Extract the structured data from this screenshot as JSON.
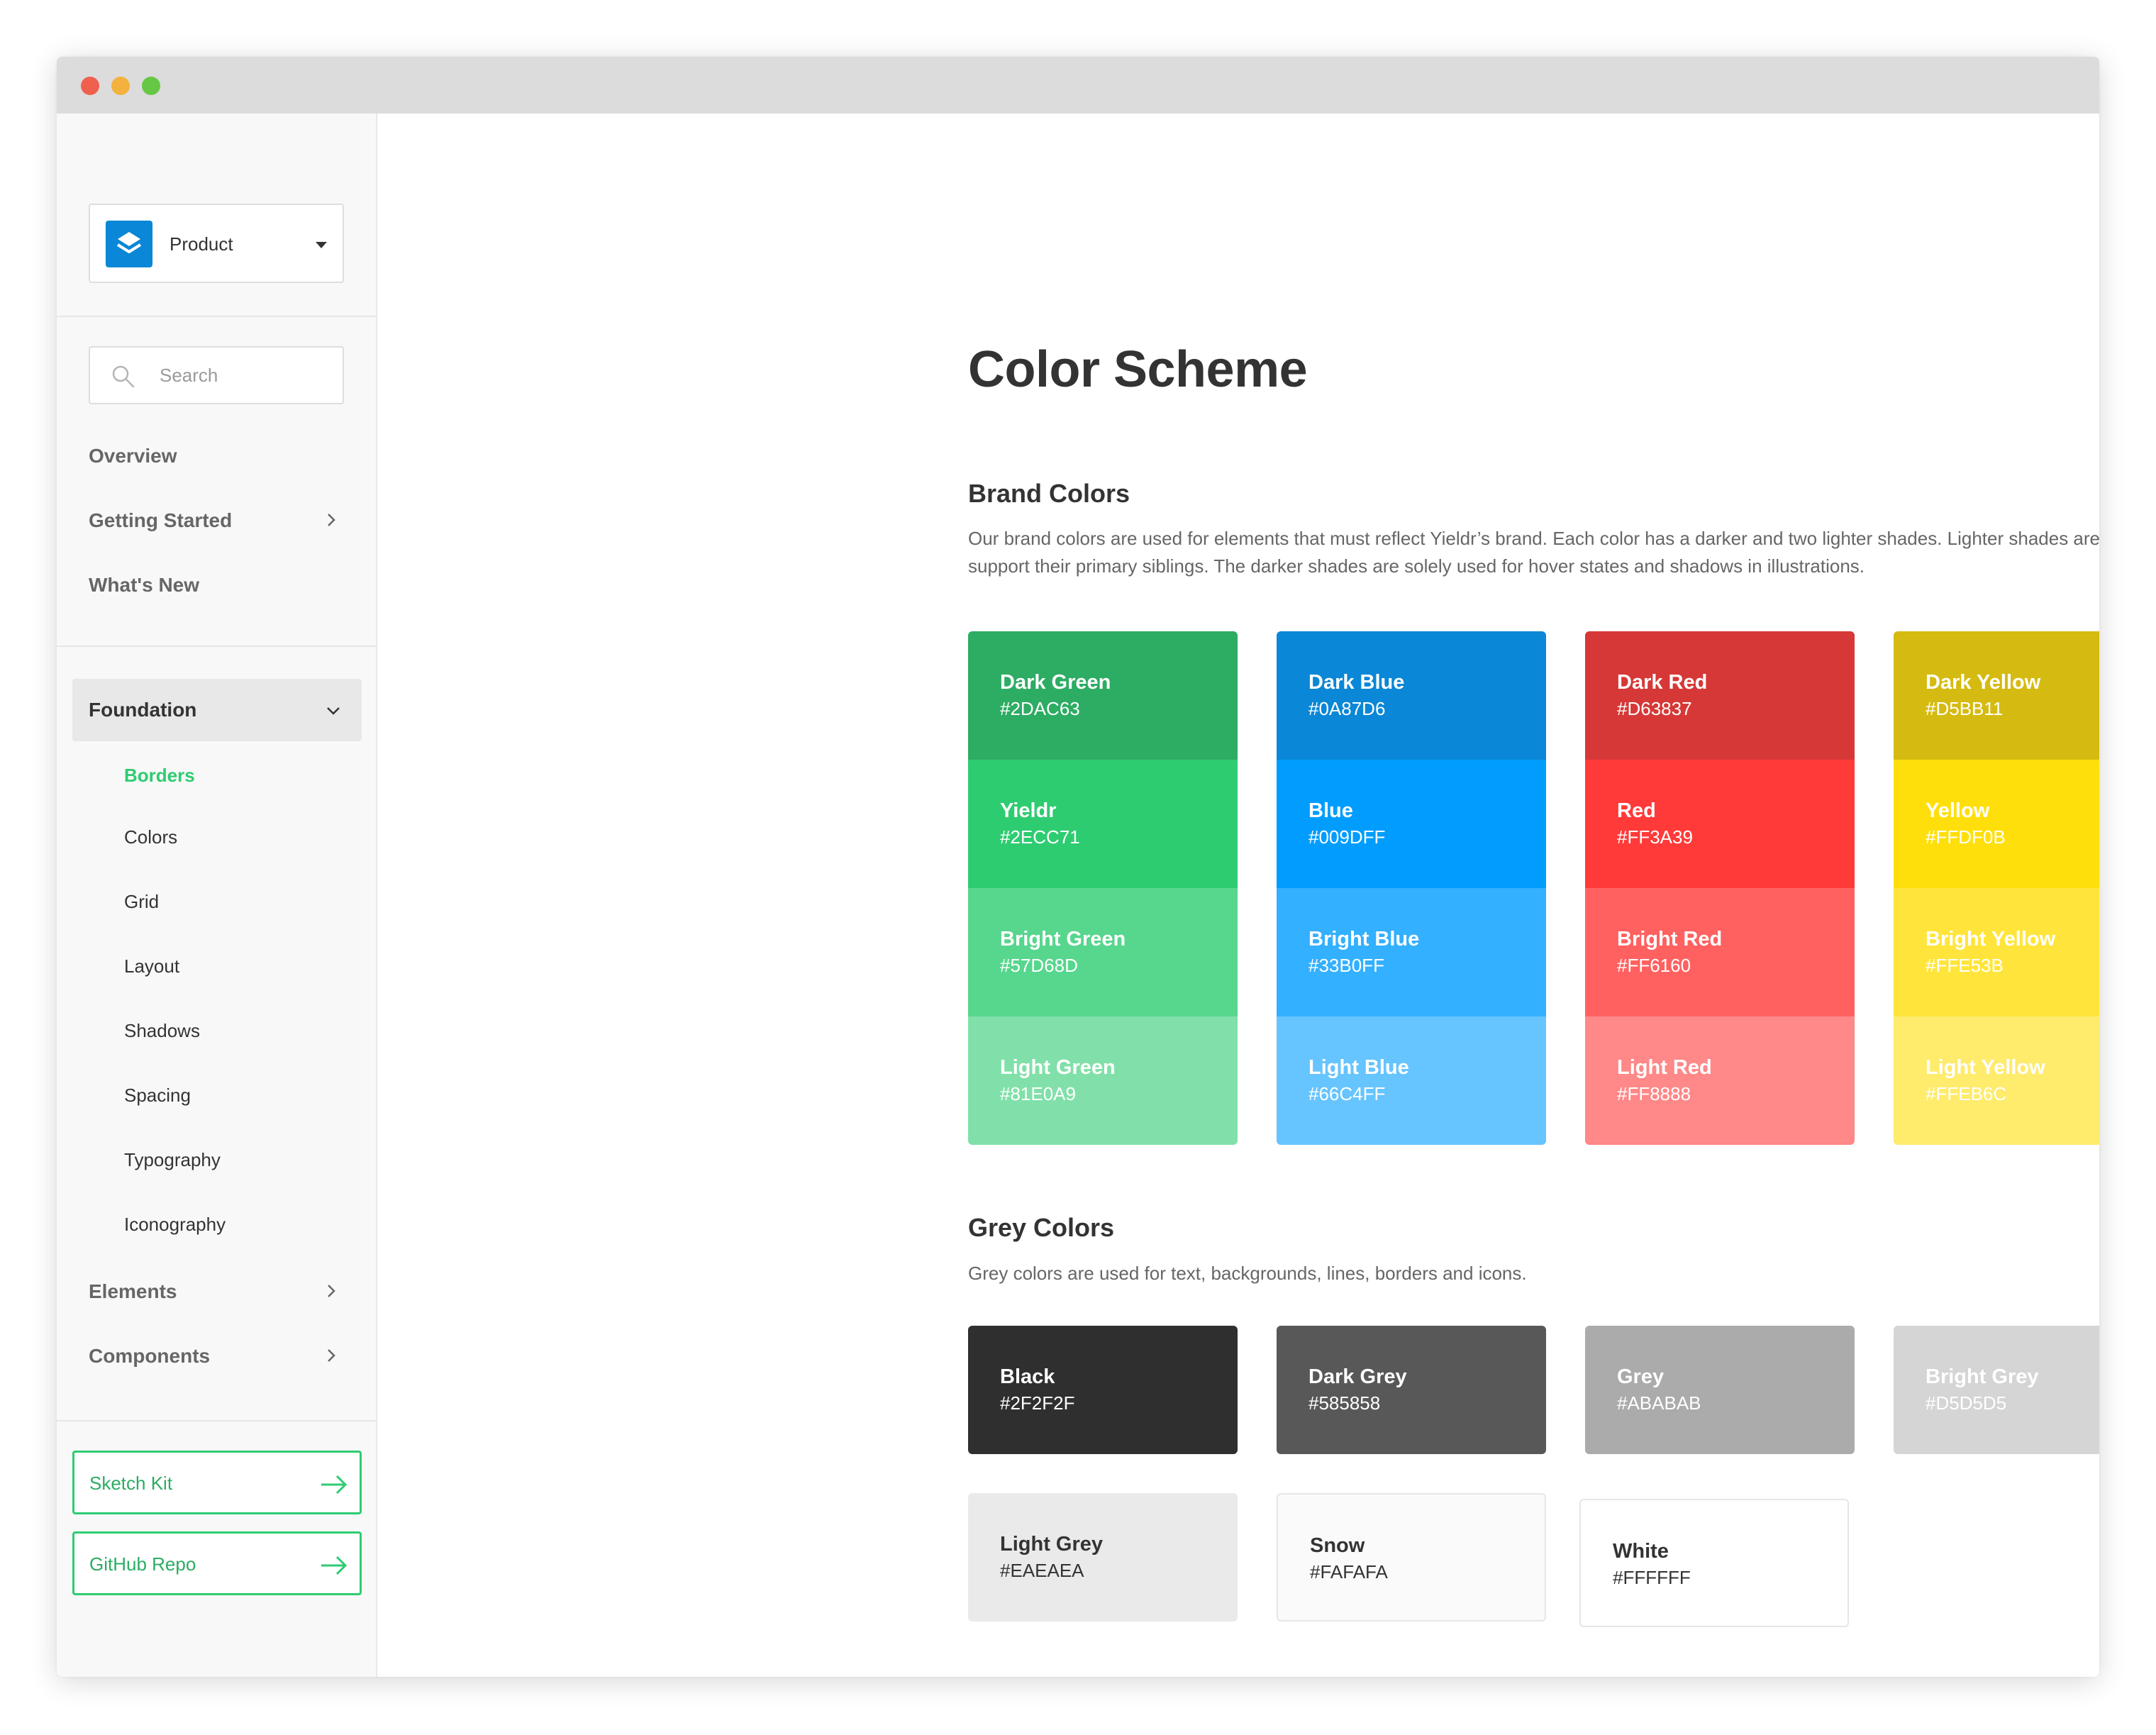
{
  "sidebar": {
    "product": {
      "label": "Product"
    },
    "search": {
      "placeholder": "Search"
    },
    "nav": {
      "overview": "Overview",
      "getting_started": "Getting Started",
      "whats_new": "What's New",
      "foundation": "Foundation",
      "foundation_items": [
        "Borders",
        "Colors",
        "Grid",
        "Layout",
        "Shadows",
        "Spacing",
        "Typography",
        "Iconography"
      ],
      "elements": "Elements",
      "components": "Components"
    },
    "links": {
      "sketch_kit": "Sketch Kit",
      "github_repo": "GitHub Repo"
    }
  },
  "main": {
    "title": "Color Scheme",
    "brand": {
      "title": "Brand Colors",
      "description": "Our brand colors are used for elements that must reflect Yieldr’s brand. Each color has a darker and two lighter shades. Lighter shades are used to support their primary siblings. The darker shades are solely used for hover states and shadows in illustrations.",
      "groups": [
        [
          {
            "name": "Dark Green",
            "hex": "#2DAC63",
            "color": "#2dac63",
            "text": "#ffffff"
          },
          {
            "name": "Yieldr",
            "hex": "#2ECC71",
            "color": "#2ecc71",
            "text": "#ffffff"
          },
          {
            "name": "Bright Green",
            "hex": "#57D68D",
            "color": "#57d68d",
            "text": "#ffffff"
          },
          {
            "name": "Light Green",
            "hex": "#81E0A9",
            "color": "#81e0a9",
            "text": "#ffffff"
          }
        ],
        [
          {
            "name": "Dark Blue",
            "hex": "#0A87D6",
            "color": "#0a87d6",
            "text": "#ffffff"
          },
          {
            "name": "Blue",
            "hex": "#009DFF",
            "color": "#009dff",
            "text": "#ffffff"
          },
          {
            "name": "Bright Blue",
            "hex": "#33B0FF",
            "color": "#33b0ff",
            "text": "#ffffff"
          },
          {
            "name": "Light Blue",
            "hex": "#66C4FF",
            "color": "#66c4ff",
            "text": "#ffffff"
          }
        ],
        [
          {
            "name": "Dark Red",
            "hex": "#D63837",
            "color": "#d63837",
            "text": "#ffffff"
          },
          {
            "name": "Red",
            "hex": "#FF3A39",
            "color": "#ff3a39",
            "text": "#ffffff"
          },
          {
            "name": "Bright Red",
            "hex": "#FF6160",
            "color": "#ff6160",
            "text": "#ffffff"
          },
          {
            "name": "Light Red",
            "hex": "#FF8888",
            "color": "#ff8888",
            "text": "#ffffff"
          }
        ],
        [
          {
            "name": "Dark Yellow",
            "hex": "#D5BB11",
            "color": "#d5bb11",
            "text": "#ffffff"
          },
          {
            "name": "Yellow",
            "hex": "#FFDF0B",
            "color": "#ffdf0b",
            "text": "#ffffff"
          },
          {
            "name": "Bright Yellow",
            "hex": "#FFE53B",
            "color": "#ffe53b",
            "text": "#ffffff"
          },
          {
            "name": "Light Yellow",
            "hex": "#FFEB6C",
            "color": "#ffeb6c",
            "text": "#ffffff"
          }
        ]
      ]
    },
    "grey": {
      "title": "Grey Colors",
      "description": "Grey colors are used for text, backgrounds, lines, borders and icons.",
      "swatches": [
        {
          "name": "Black",
          "hex": "#2F2F2F",
          "color": "#2f2f2f",
          "text": "#ffffff"
        },
        {
          "name": "Dark Grey",
          "hex": "#585858",
          "color": "#585858",
          "text": "#ffffff"
        },
        {
          "name": "Grey",
          "hex": "#ABABAB",
          "color": "#ababab",
          "text": "#ffffff"
        },
        {
          "name": "Bright Grey",
          "hex": "#D5D5D5",
          "color": "#d5d5d5",
          "text": "#ffffff"
        },
        {
          "name": "Light Grey",
          "hex": "#EAEAEA",
          "color": "#eaeaea",
          "text": "#333333"
        },
        {
          "name": "Snow",
          "hex": "#FAFAFA",
          "color": "#fafafa",
          "text": "#333333"
        },
        {
          "name": "White",
          "hex": "#FFFFFF",
          "color": "#ffffff",
          "text": "#333333"
        }
      ]
    }
  }
}
